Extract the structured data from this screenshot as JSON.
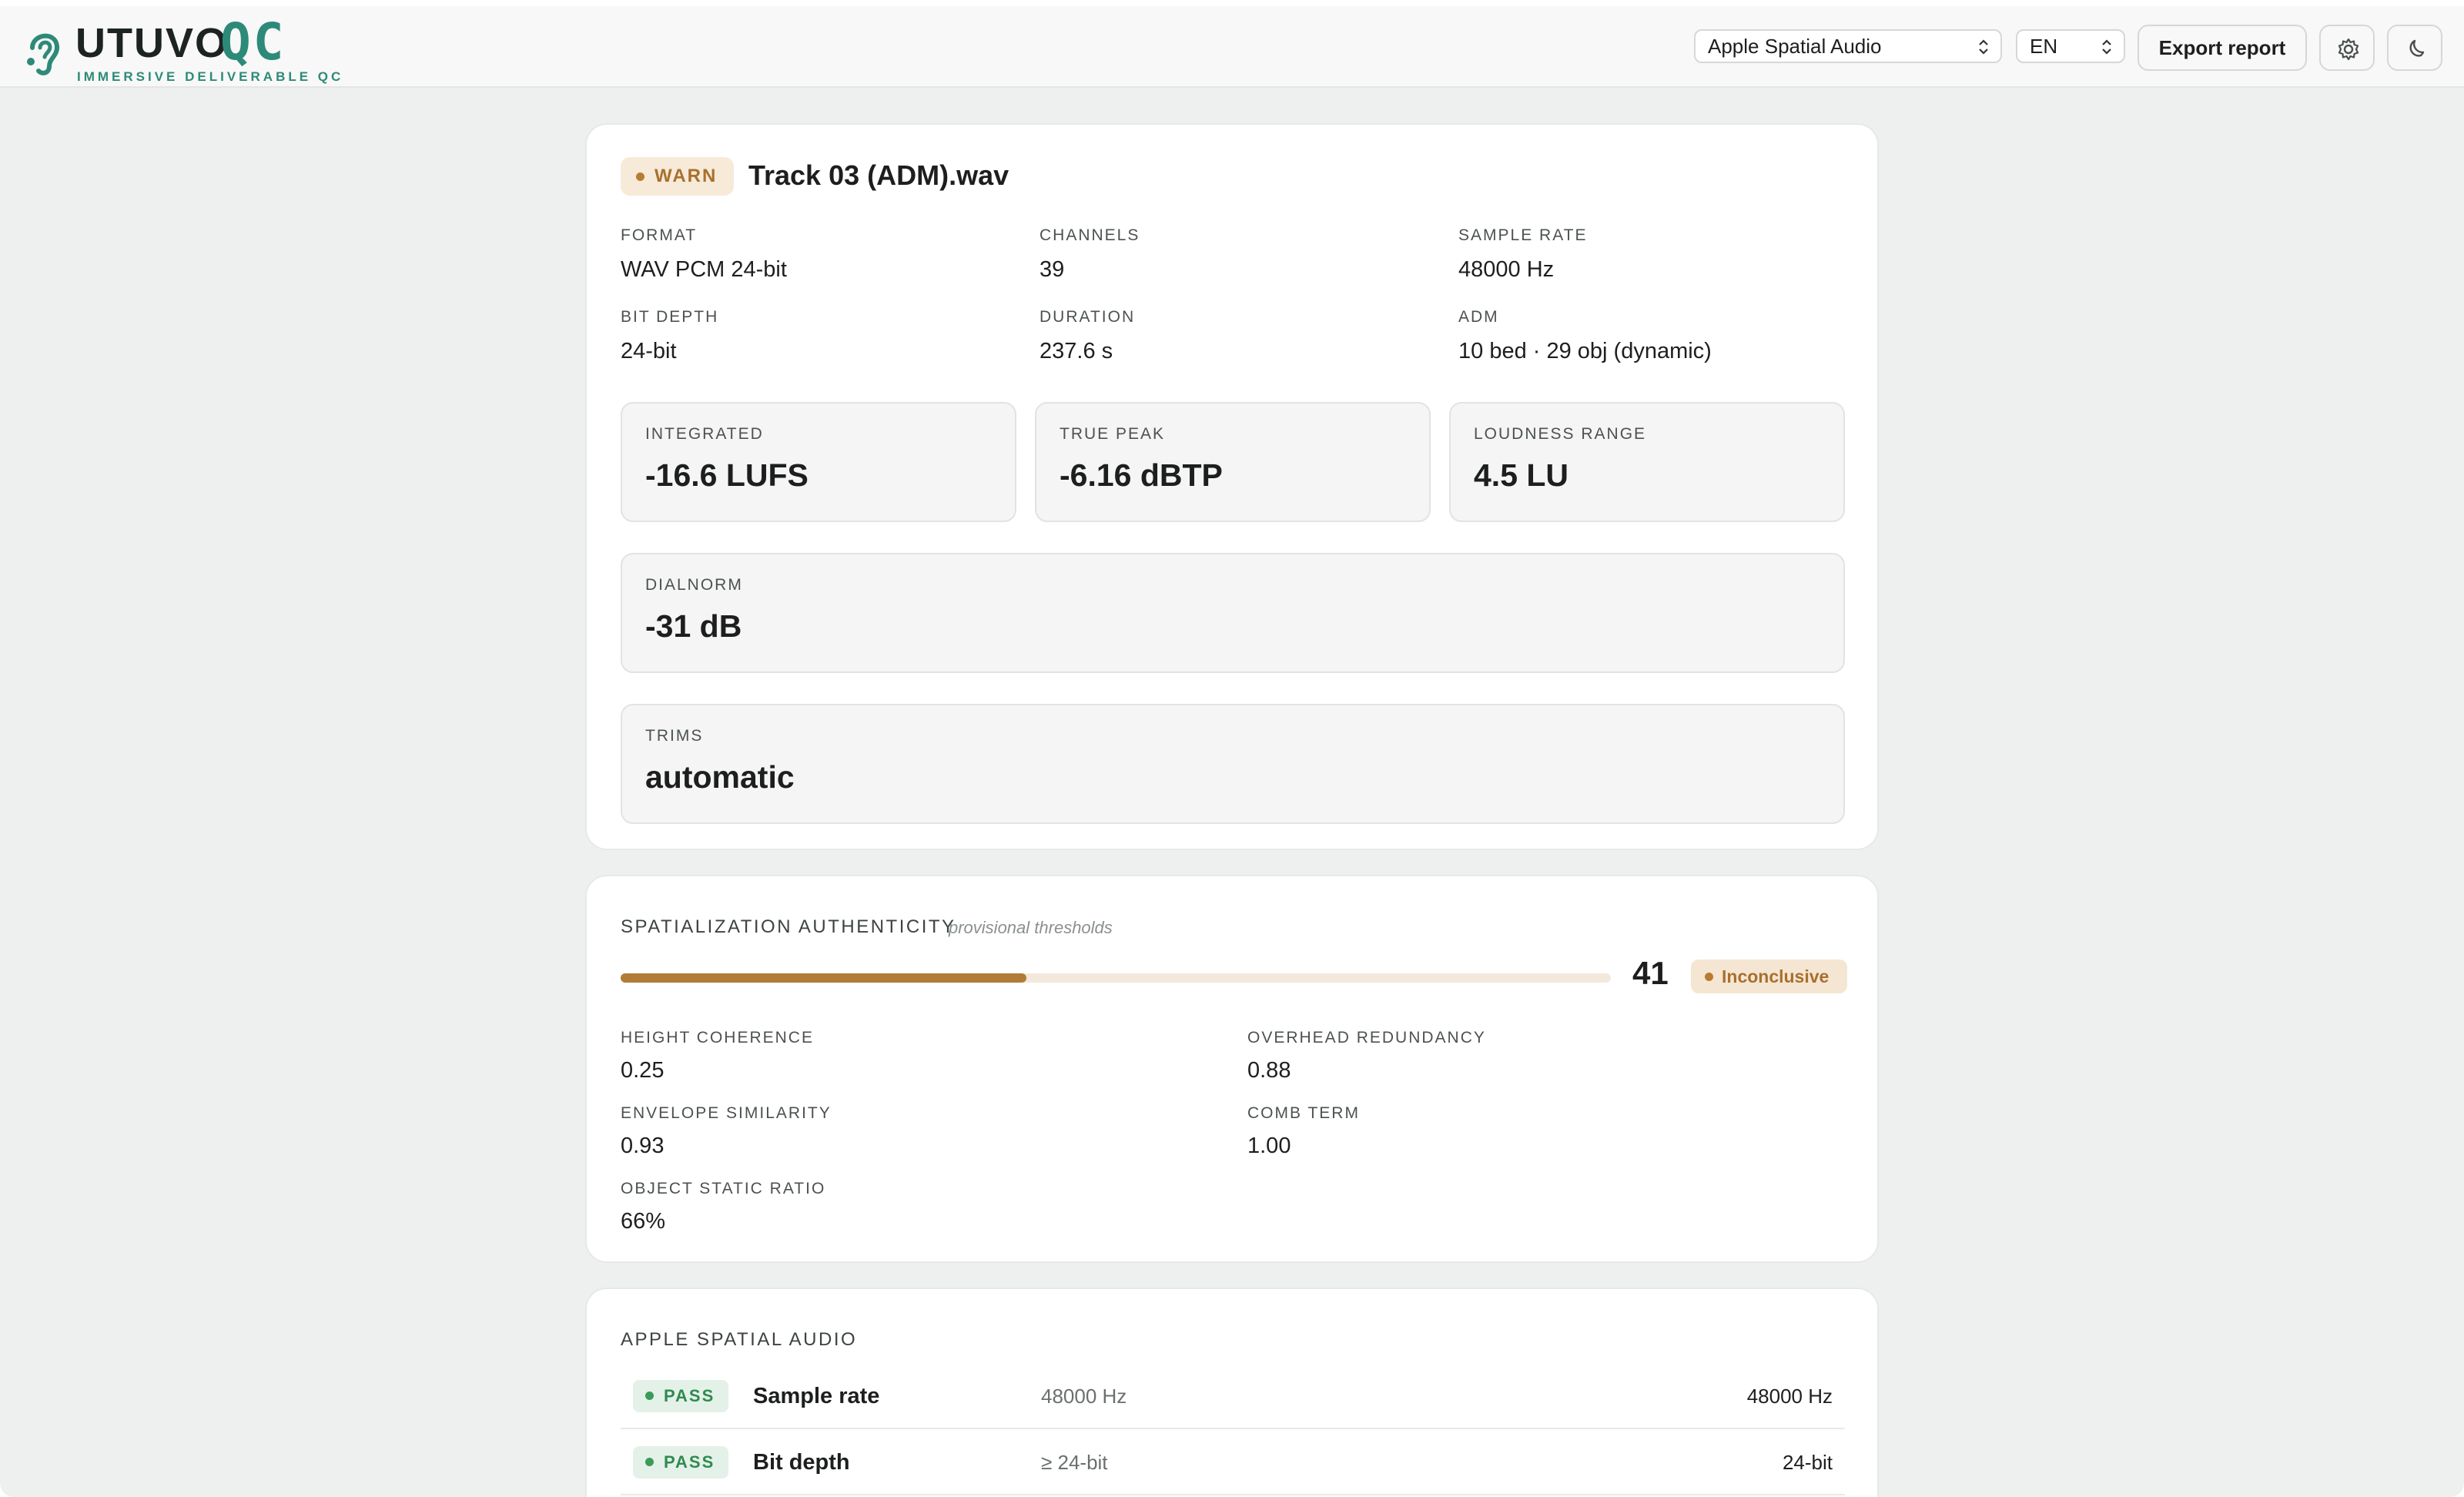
{
  "header": {
    "logo_word": "UTUVO",
    "logo_qc": "QC",
    "logo_sub": "IMMERSIVE DELIVERABLE QC",
    "profile_select": "Apple Spatial Audio",
    "language_select": "EN",
    "export_label": "Export report",
    "settings_icon": "gear-icon",
    "theme_icon": "moon-icon"
  },
  "file": {
    "status": "WARN",
    "name": "Track 03 (ADM).wav",
    "fields": [
      {
        "label": "FORMAT",
        "value": "WAV PCM 24-bit"
      },
      {
        "label": "CHANNELS",
        "value": "39"
      },
      {
        "label": "SAMPLE RATE",
        "value": "48000 Hz"
      },
      {
        "label": "BIT DEPTH",
        "value": "24-bit"
      },
      {
        "label": "DURATION",
        "value": "237.6 s"
      },
      {
        "label": "ADM",
        "value": "10 bed · 29 obj (dynamic)"
      }
    ],
    "metrics": [
      {
        "label": "INTEGRATED",
        "value": "-16.6 LUFS"
      },
      {
        "label": "TRUE PEAK",
        "value": "-6.16 dBTP"
      },
      {
        "label": "LOUDNESS RANGE",
        "value": "4.5 LU"
      }
    ],
    "dialnorm": {
      "label": "DIALNORM",
      "value": "-31 dB"
    },
    "trims": {
      "label": "TRIMS",
      "value": "automatic"
    }
  },
  "spatial": {
    "title": "SPATIALIZATION AUTHENTICITY",
    "note": "provisional thresholds",
    "score": "41",
    "score_fraction": 0.41,
    "verdict": "Inconclusive",
    "metrics": [
      {
        "label": "HEIGHT COHERENCE",
        "value": "0.25"
      },
      {
        "label": "OVERHEAD REDUNDANCY",
        "value": "0.88"
      },
      {
        "label": "ENVELOPE SIMILARITY",
        "value": "0.93"
      },
      {
        "label": "COMB TERM",
        "value": "1.00"
      },
      {
        "label": "OBJECT STATIC RATIO",
        "value": "66%"
      }
    ]
  },
  "checks": {
    "title": "APPLE SPATIAL AUDIO",
    "rows": [
      {
        "status": "PASS",
        "name": "Sample rate",
        "requirement": "48000 Hz",
        "actual": "48000 Hz"
      },
      {
        "status": "PASS",
        "name": "Bit depth",
        "requirement": "≥ 24-bit",
        "actual": "24-bit"
      }
    ]
  },
  "colors": {
    "accent": "#2d8a78",
    "warn": "#b07c37",
    "pass": "#2e8b4f"
  }
}
